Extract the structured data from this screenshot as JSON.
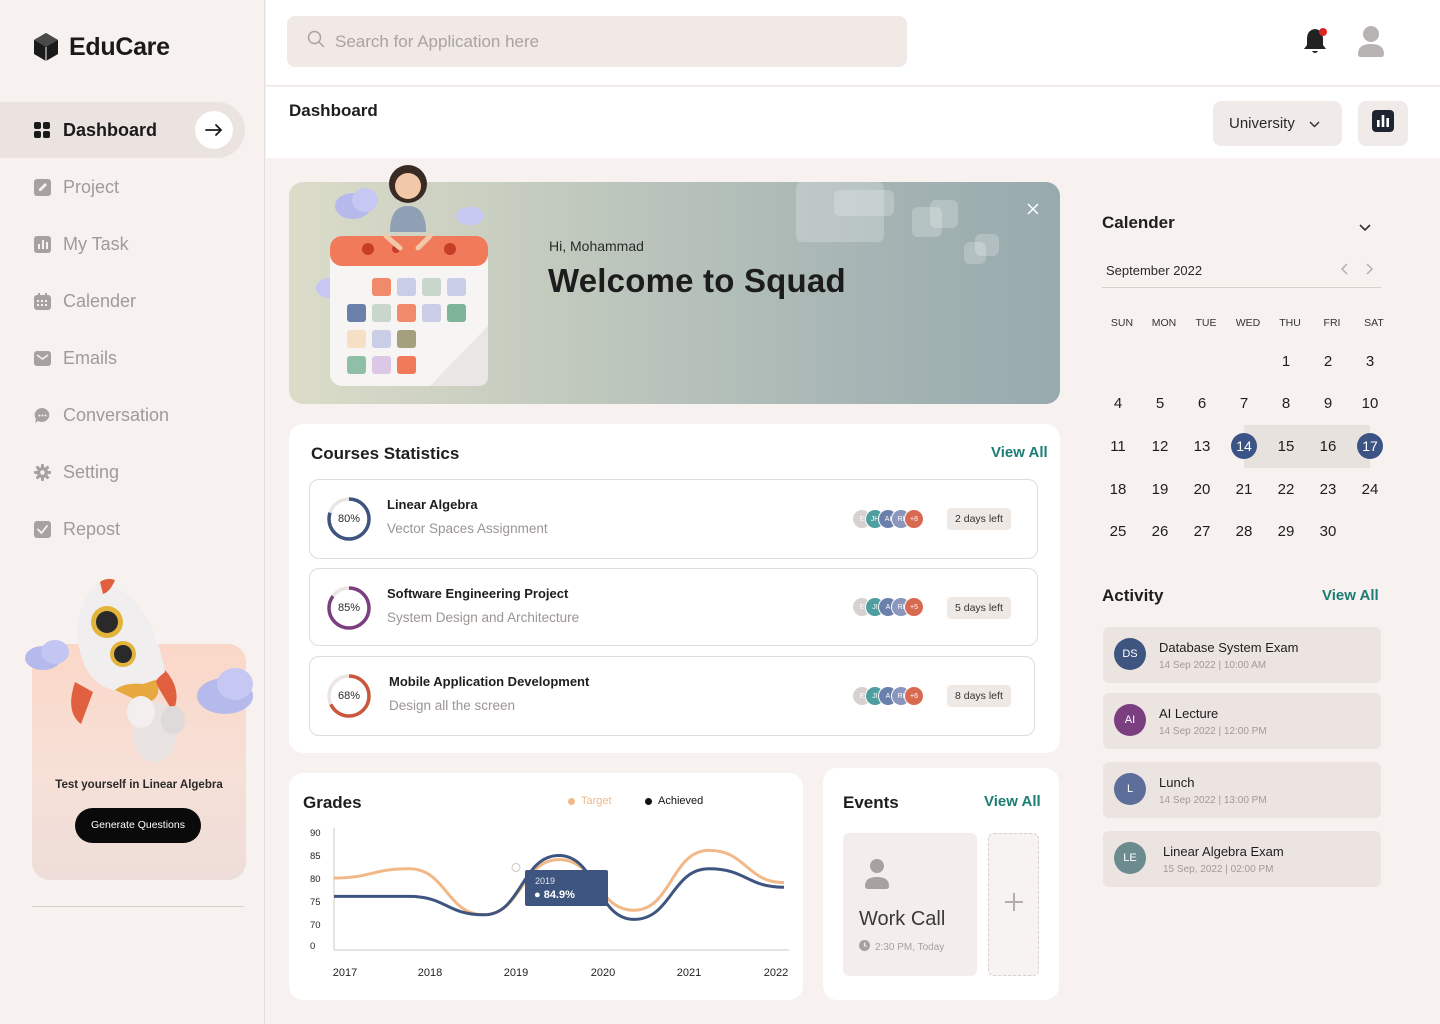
{
  "app": {
    "name": "EduCare"
  },
  "sidebar": {
    "items": [
      {
        "label": "Dashboard",
        "icon": "grid-icon",
        "active": true
      },
      {
        "label": "Project",
        "icon": "edit-icon"
      },
      {
        "label": "My Task",
        "icon": "bar-chart-icon"
      },
      {
        "label": "Calender",
        "icon": "calendar-icon"
      },
      {
        "label": "Emails",
        "icon": "mail-icon"
      },
      {
        "label": "Conversation",
        "icon": "chat-icon"
      },
      {
        "label": "Setting",
        "icon": "gear-icon"
      },
      {
        "label": "Repost",
        "icon": "check-icon"
      }
    ],
    "promo": {
      "text": "Test yourself in Linear Algebra",
      "button": "Generate Questions"
    }
  },
  "topbar": {
    "search_placeholder": "Search for Application here",
    "has_notification": true
  },
  "header": {
    "title": "Dashboard",
    "select_value": "University"
  },
  "banner": {
    "greeting": "Hi, Mohammad",
    "title": "Welcome to Squad"
  },
  "courses": {
    "title": "Courses Statistics",
    "view_all": "View All",
    "items": [
      {
        "name": "Linear Algebra",
        "subtitle": "Vector Spaces Assignment",
        "percent": 80,
        "percent_label": "80%",
        "color": "#3e5580",
        "avatars": [
          "E",
          "JH",
          "AI",
          "RI"
        ],
        "extra": "+8",
        "due": "2 days left"
      },
      {
        "name": "Software Engineering Project",
        "subtitle": "System Design and Architecture",
        "percent": 85,
        "percent_label": "85%",
        "color": "#7b3f7f",
        "avatars": [
          "E",
          "JI",
          "A",
          "RI"
        ],
        "extra": "+5",
        "due": "5 days left"
      },
      {
        "name": "Mobile Application Development",
        "subtitle": "Design all the screen",
        "percent": 68,
        "percent_label": "68%",
        "color": "#c9573b",
        "avatars": [
          "E",
          "JI",
          "A",
          "RI"
        ],
        "extra": "+6",
        "due": "8 days left"
      }
    ]
  },
  "grades": {
    "title": "Grades",
    "legend_target": "Target",
    "legend_achieved": "Achieved",
    "tooltip_year": "2019",
    "tooltip_value": "● 84.9%"
  },
  "chart_data": {
    "type": "line",
    "title": "Grades",
    "x": [
      "2017",
      "2018",
      "2019",
      "2020",
      "2021",
      "2022"
    ],
    "y_ticks": [
      "90",
      "85",
      "80",
      "75",
      "70",
      "0"
    ],
    "series": [
      {
        "name": "Target",
        "color": "#f2b887",
        "values": [
          80,
          82,
          72,
          84,
          73,
          86,
          79
        ]
      },
      {
        "name": "Achieved",
        "color": "#3e5580",
        "values": [
          76,
          76,
          72,
          84.9,
          71,
          82,
          78
        ]
      }
    ]
  },
  "events": {
    "title": "Events",
    "view_all": "View All",
    "items": [
      {
        "title": "Work Call",
        "time": "2:30 PM, Today"
      }
    ]
  },
  "calendar": {
    "title": "Calender",
    "month": "September 2022",
    "weekdays": [
      "SUN",
      "MON",
      "TUE",
      "WED",
      "THU",
      "FRI",
      "SAT"
    ],
    "leading_blank": 4,
    "days": 30,
    "range_start": 14,
    "range_end": 17
  },
  "activity": {
    "title": "Activity",
    "view_all": "View All",
    "items": [
      {
        "initials": "DS",
        "title": "Database System Exam",
        "time": "14 Sep 2022 | 10:00 AM",
        "color": "#3e5580"
      },
      {
        "initials": "AI",
        "title": "AI Lecture",
        "time": "14 Sep 2022 | 12:00 PM",
        "color": "#7b3f7f"
      },
      {
        "initials": "L",
        "title": "Lunch",
        "time": "14 Sep 2022 | 13:00 PM",
        "color": "#5c6e99"
      },
      {
        "initials": "LE",
        "title": "Linear Algebra Exam",
        "time": "15 Sep, 2022 | 02:00 PM",
        "color": "#6b8b8f"
      }
    ]
  }
}
